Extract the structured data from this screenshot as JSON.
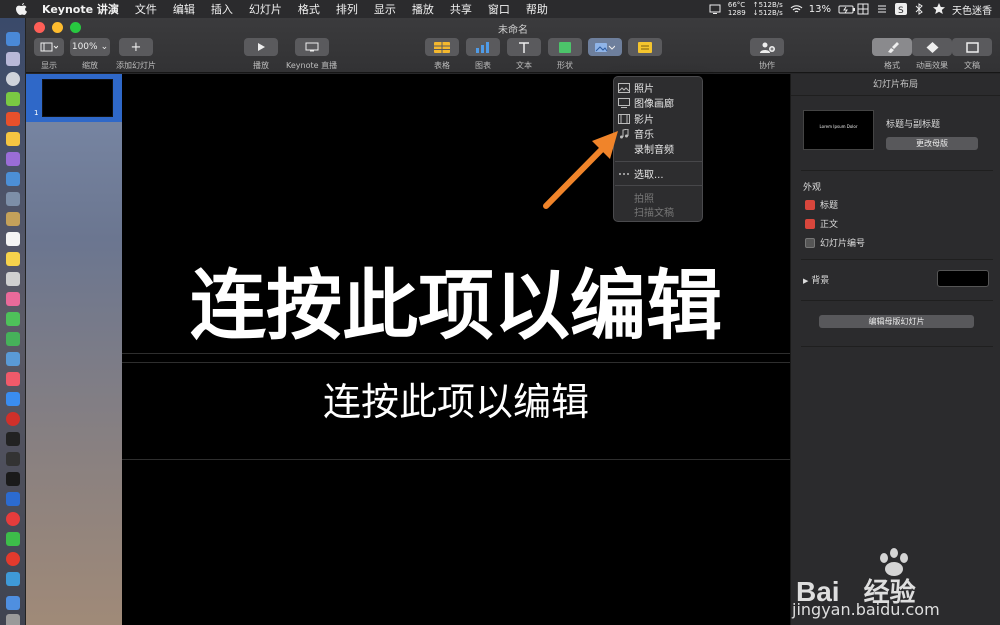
{
  "menubar": {
    "app": "Keynote 讲演",
    "items": [
      "文件",
      "编辑",
      "插入",
      "幻灯片",
      "格式",
      "排列",
      "显示",
      "播放",
      "共享",
      "窗口",
      "帮助"
    ],
    "temp": "66°C",
    "fan": "1289",
    "net_up": "↑512B/s",
    "net_down": "↓512B/s",
    "battery": "13%",
    "user": "天色迷香"
  },
  "window": {
    "title": "未命名"
  },
  "toolbar": {
    "view_label": "显示",
    "zoom_value": "100%",
    "zoom_label": "缩放",
    "add_slide_label": "添加幻灯片",
    "play_label": "播放",
    "live_label": "Keynote 直播",
    "table_label": "表格",
    "chart_label": "图表",
    "text_label": "文本",
    "shape_label": "形状",
    "collab_label": "协作",
    "format_label": "格式",
    "animate_label": "动画效果",
    "document_label": "文稿"
  },
  "media_menu": {
    "items": [
      "照片",
      "图像画廊",
      "影片",
      "音乐",
      "录制音频"
    ],
    "choose": "选取...",
    "disabled": [
      "拍照",
      "扫描文稿"
    ]
  },
  "navigator": {
    "slide_number": "1"
  },
  "slide": {
    "title": "连按此项以编辑",
    "body": "连按此项以编辑"
  },
  "inspector": {
    "header": "幻灯片布局",
    "layout_thumb_text": "Lorem Ipsum Dolor",
    "layout_name": "标题与副标题",
    "change_master": "更改母版",
    "appearance": "外观",
    "checks": [
      {
        "label": "标题",
        "checked": true
      },
      {
        "label": "正文",
        "checked": true
      },
      {
        "label": "幻灯片编号",
        "checked": false
      }
    ],
    "background": "背景",
    "edit_master": "编辑母版幻灯片"
  },
  "watermark": {
    "brand": "Bai",
    "brand2": "经验",
    "url": "jingyan.baidu.com"
  },
  "colors": {
    "accent_orange": "#f0842a",
    "selection_blue": "#2f68c8",
    "checkbox_red": "#d8463c"
  }
}
